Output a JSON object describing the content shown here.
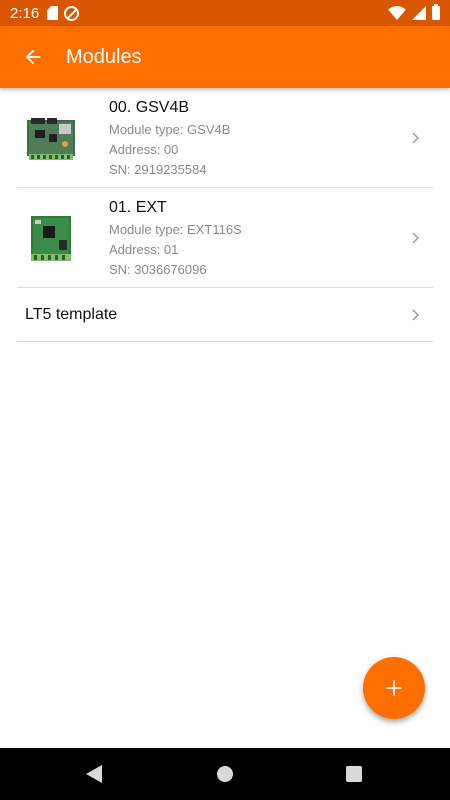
{
  "status_bar": {
    "time": "2:16",
    "icons": [
      "sd-card-icon",
      "do-not-disturb-icon",
      "wifi-icon",
      "signal-icon",
      "battery-icon"
    ]
  },
  "app_bar": {
    "title": "Modules",
    "background_color": "#ff6f00",
    "status_color": "#d85600"
  },
  "modules": [
    {
      "title": "00. GSV4B",
      "type_line": "Module type: GSV4B",
      "address_line": "Address: 00",
      "sn_line": "SN: 2919235584"
    },
    {
      "title": "01. EXT",
      "type_line": "Module type: EXT116S",
      "address_line": "Address: 01",
      "sn_line": "SN: 3036676096"
    }
  ],
  "template": {
    "label": "LT5 template"
  },
  "fab": {
    "icon": "plus-icon"
  },
  "nav_bar": {
    "icons": [
      "nav-back-icon",
      "nav-home-icon",
      "nav-recents-icon"
    ]
  }
}
